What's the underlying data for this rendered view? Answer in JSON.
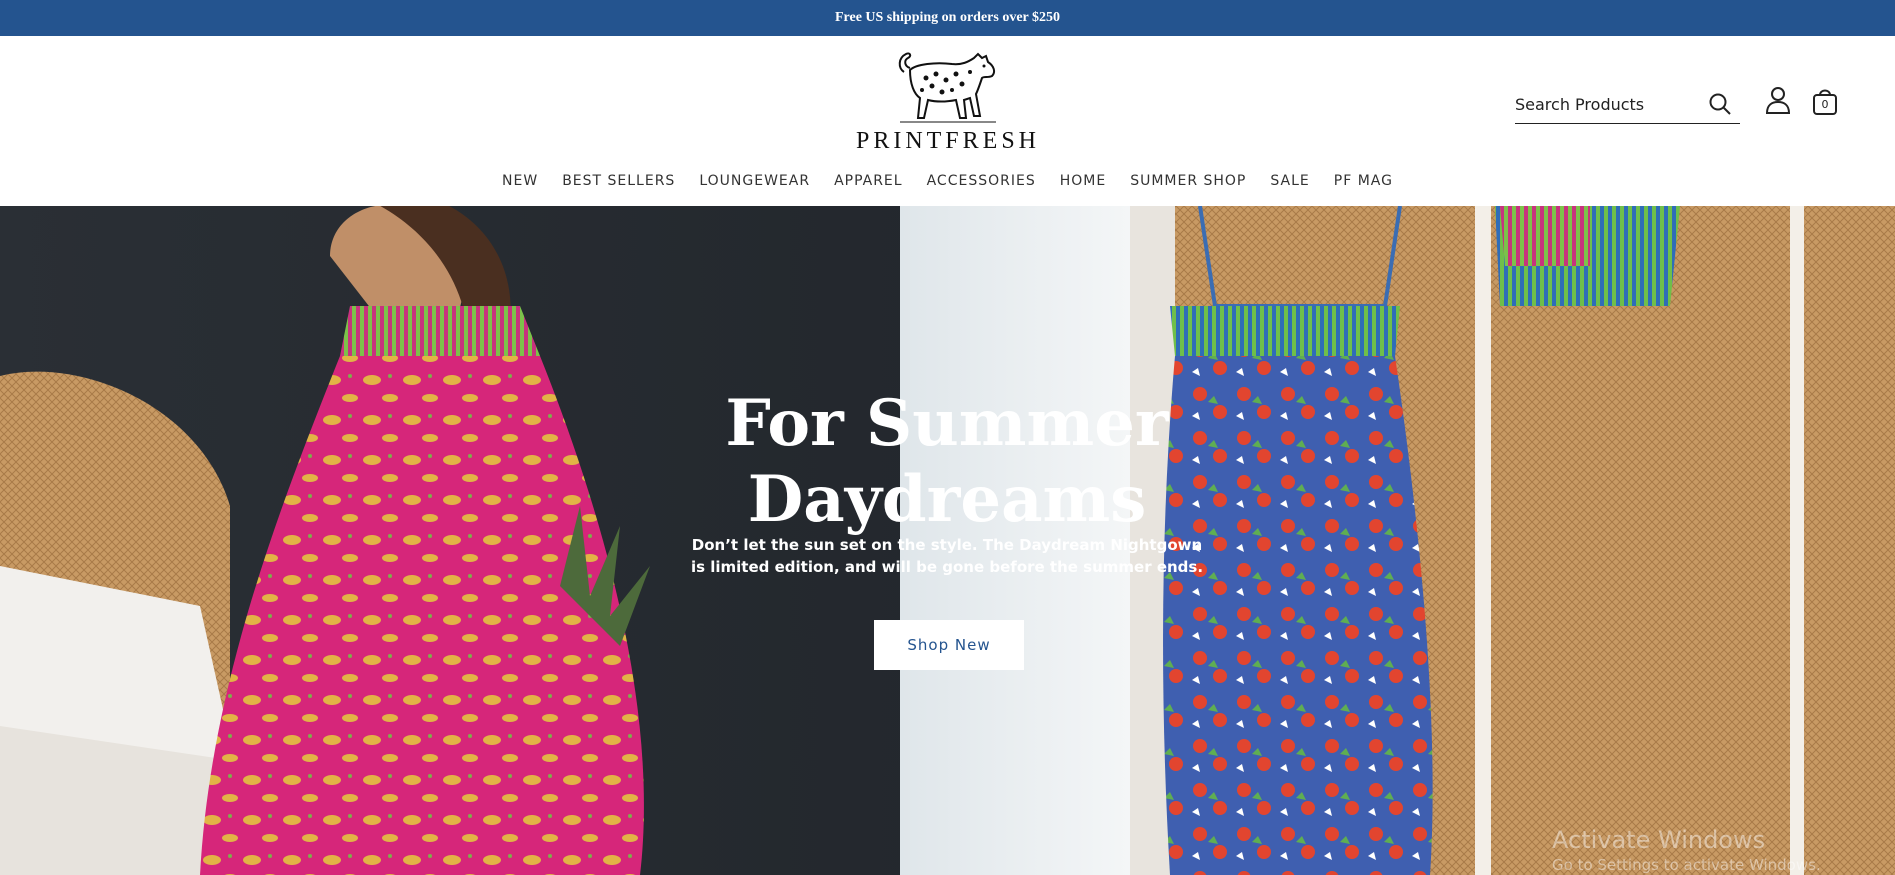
{
  "announcement": {
    "text": "Free US shipping on orders over $250"
  },
  "logo": {
    "text": "PRINTFRESH",
    "icon": "leopard-logo-icon"
  },
  "search": {
    "placeholder": "Search Products",
    "icon": "search-icon"
  },
  "account": {
    "icon": "account-icon"
  },
  "cart": {
    "icon": "shopping-bag-icon",
    "count": "0"
  },
  "nav": {
    "items": [
      {
        "label": "NEW"
      },
      {
        "label": "BEST SELLERS"
      },
      {
        "label": "LOUNGEWEAR"
      },
      {
        "label": "APPAREL"
      },
      {
        "label": "ACCESSORIES"
      },
      {
        "label": "HOME"
      },
      {
        "label": "SUMMER SHOP"
      },
      {
        "label": "SALE"
      },
      {
        "label": "PF MAG"
      }
    ]
  },
  "hero": {
    "title_line1": "For Summer",
    "title_line2": "Daydreams",
    "subtitle_line1": "Don’t let the sun set on the style. The Daydream Nightgown",
    "subtitle_line2": "is limited edition, and will be gone before the summer ends.",
    "button_label": "Shop New"
  },
  "os_watermark": {
    "title": "Activate Windows",
    "subtitle": "Go to Settings to activate Windows."
  },
  "colors": {
    "announcement_bg": "#24548f",
    "button_text": "#24548f"
  }
}
